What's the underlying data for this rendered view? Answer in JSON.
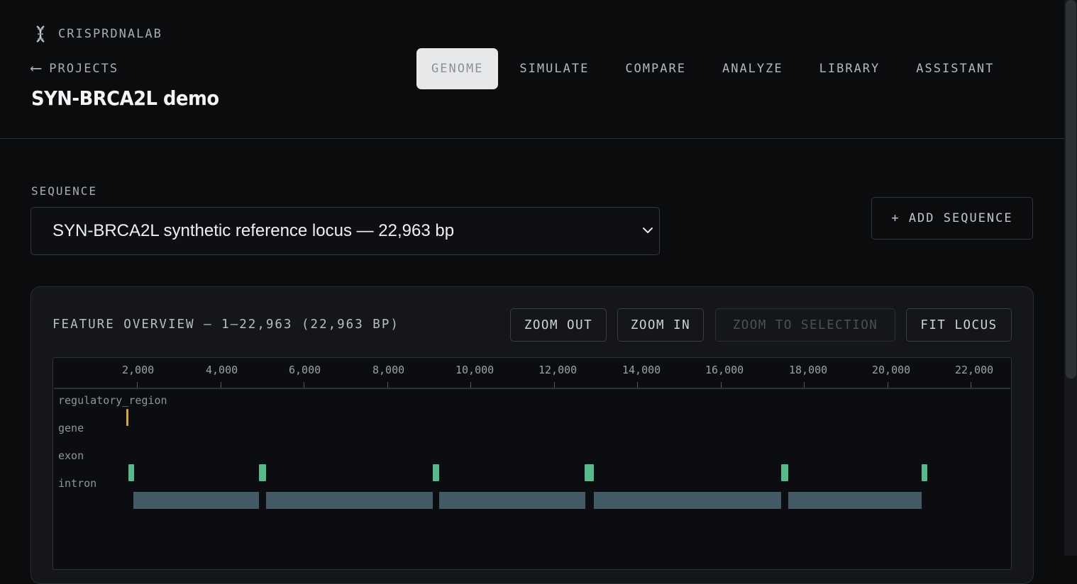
{
  "app": {
    "brand": "CRISPRDNALAB"
  },
  "header": {
    "back_label": "PROJECTS",
    "back_arrow": "⟵",
    "project_title": "SYN-BRCA2L demo"
  },
  "nav": {
    "tabs": [
      {
        "label": "GENOME",
        "active": true
      },
      {
        "label": "SIMULATE",
        "active": false
      },
      {
        "label": "COMPARE",
        "active": false
      },
      {
        "label": "ANALYZE",
        "active": false
      },
      {
        "label": "LIBRARY",
        "active": false
      },
      {
        "label": "ASSISTANT",
        "active": false
      }
    ]
  },
  "sequence": {
    "label": "SEQUENCE",
    "selected": "SYN-BRCA2L synthetic reference locus — 22,963 bp",
    "add_button": "+ ADD SEQUENCE"
  },
  "feature_overview": {
    "title": "FEATURE OVERVIEW — 1–22,963 (22,963 BP)",
    "buttons": {
      "zoom_out": "ZOOM OUT",
      "zoom_in": "ZOOM IN",
      "zoom_to_selection": "ZOOM TO SELECTION",
      "fit_locus": "FIT LOCUS"
    },
    "zoom_to_selection_enabled": false,
    "axis_ticks": [
      "2,000",
      "4,000",
      "6,000",
      "8,000",
      "10,000",
      "12,000",
      "14,000",
      "16,000",
      "18,000",
      "20,000",
      "22,000"
    ],
    "lanes": [
      "regulatory_region",
      "gene",
      "exon",
      "intron"
    ],
    "colors": {
      "regulatory_region": "#d9a443",
      "exon": "#58b98c",
      "intron": "#435a67"
    }
  },
  "icons": {
    "brand": "dna-icon",
    "back": "arrow-left-icon",
    "select": "chevron-down-icon"
  }
}
